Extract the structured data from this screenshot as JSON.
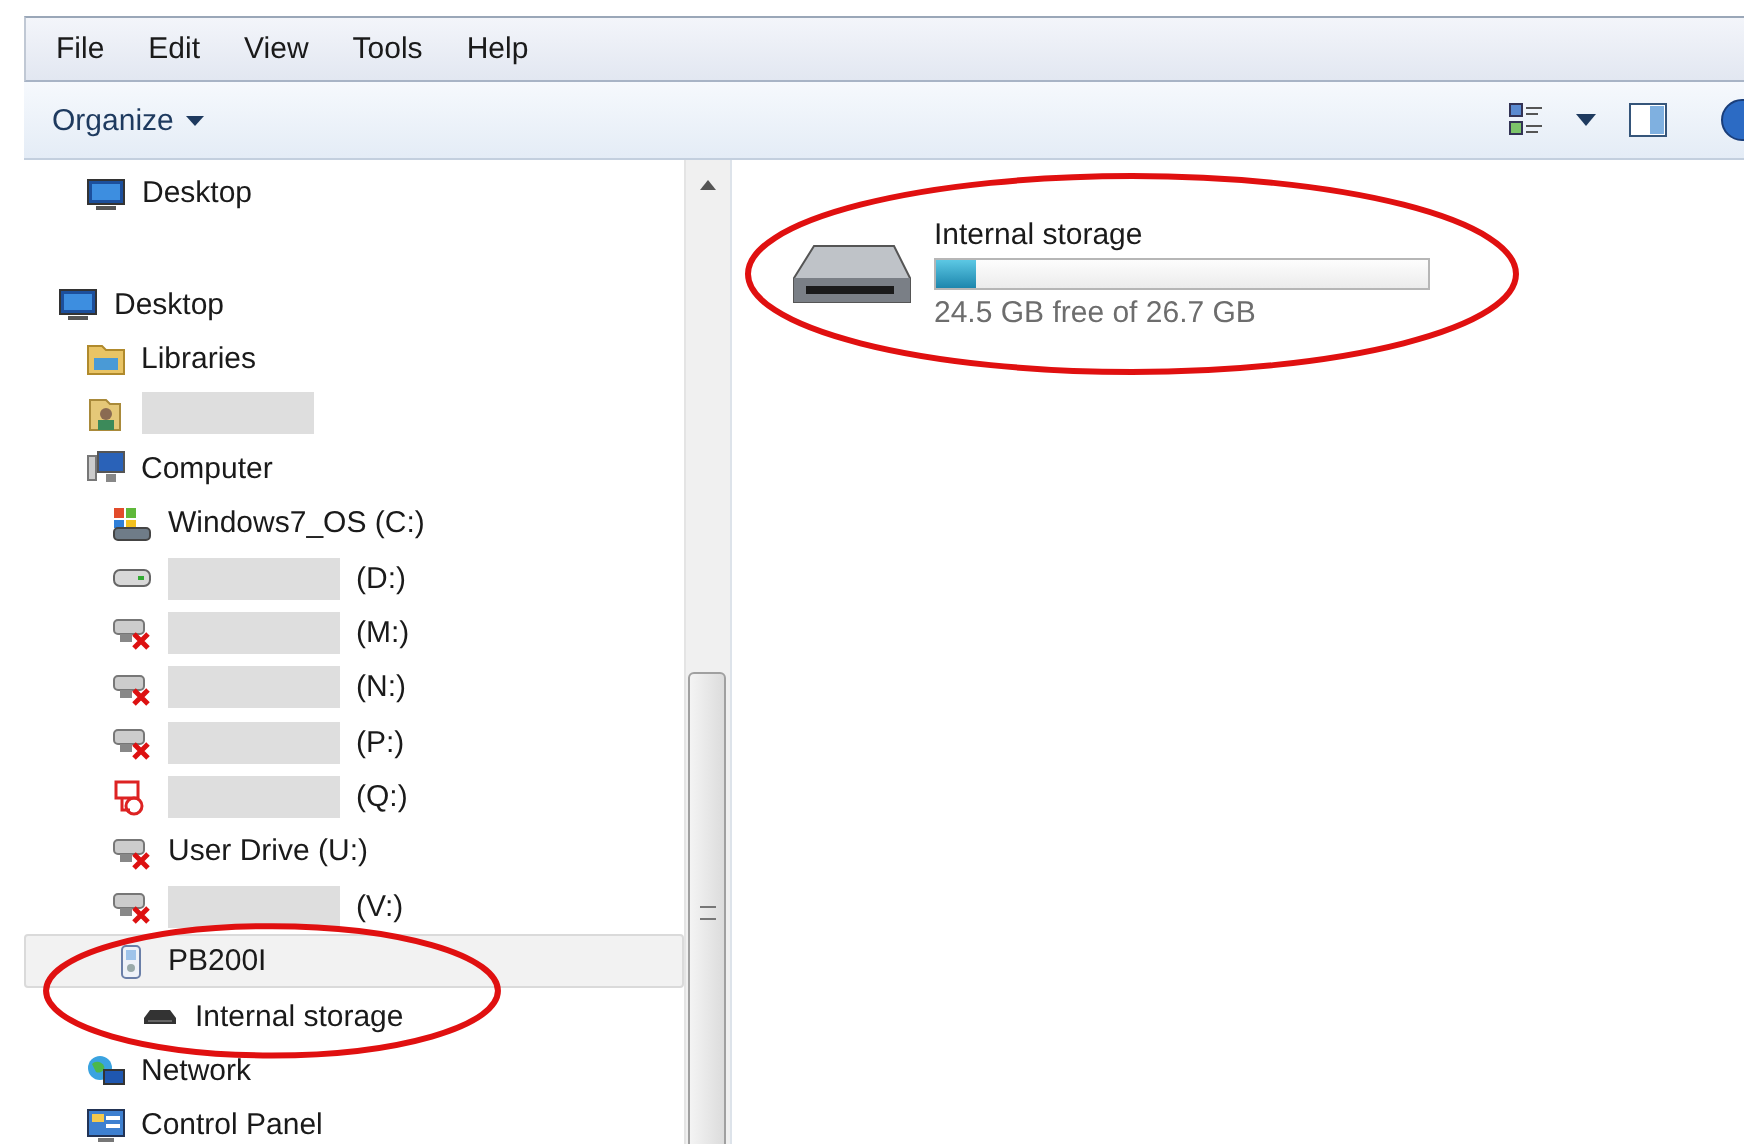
{
  "menu": [
    "File",
    "Edit",
    "View",
    "Tools",
    "Help"
  ],
  "toolbar": {
    "organize": "Organize"
  },
  "favorites": [
    {
      "label": "Desktop",
      "kind": "monitor",
      "selected": false,
      "redacted": false
    }
  ],
  "tree": [
    {
      "label": "Desktop",
      "kind": "monitor",
      "selected": false,
      "redacted": false,
      "children": [
        {
          "label": "Libraries",
          "kind": "libraries",
          "selected": false,
          "redacted": false
        },
        {
          "kind": "user",
          "selected": false,
          "redacted": true
        },
        {
          "label": "Computer",
          "kind": "computer",
          "selected": false,
          "redacted": false,
          "children": [
            {
              "label": "Windows7_OS (C:)",
              "kind": "os",
              "selected": false,
              "redacted": false
            },
            {
              "label": "(D:)",
              "kind": "disk",
              "selected": false,
              "redacted": true
            },
            {
              "label": "(M:)",
              "kind": "netdisk",
              "selected": false,
              "redacted": true
            },
            {
              "label": "(N:)",
              "kind": "netdisk",
              "selected": false,
              "redacted": true
            },
            {
              "label": "(P:)",
              "kind": "netdisk",
              "selected": false,
              "redacted": true
            },
            {
              "label": "(Q:)",
              "kind": "alert",
              "selected": false,
              "redacted": true
            },
            {
              "label": "User Drive (U:)",
              "kind": "netdisk",
              "selected": false,
              "redacted": false
            },
            {
              "label": "(V:)",
              "kind": "netdisk",
              "selected": false,
              "redacted": true
            },
            {
              "label": "PB200I",
              "kind": "device",
              "selected": true,
              "redacted": false,
              "children": [
                {
                  "label": "Internal storage",
                  "kind": "storage",
                  "selected": false,
                  "redacted": false
                }
              ]
            }
          ]
        },
        {
          "label": "Network",
          "kind": "network",
          "selected": false,
          "redacted": false
        },
        {
          "label": "Control Panel",
          "kind": "panel",
          "selected": false,
          "redacted": false
        }
      ]
    }
  ],
  "drives": [
    {
      "name": "Internal storage",
      "level": 0.082,
      "free_text": "24.5 GB free of 26.7 GB"
    }
  ],
  "annotations": {
    "tree_ellipse": true,
    "drive_ellipse": true
  }
}
